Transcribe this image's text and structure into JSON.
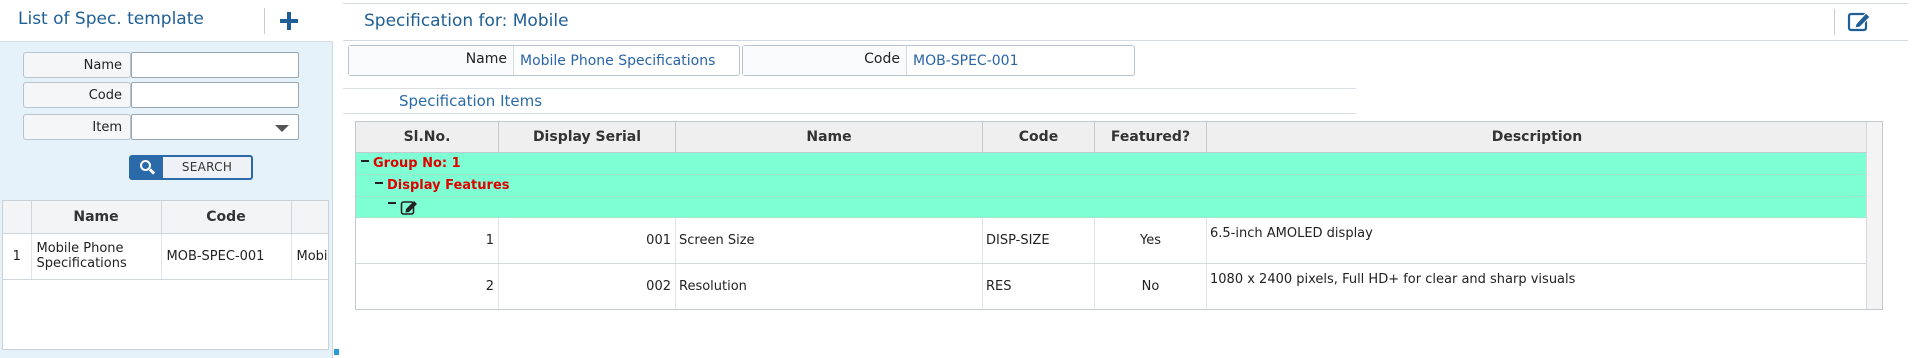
{
  "left_panel": {
    "title": "List of Spec. template",
    "filters": {
      "name_label": "Name",
      "name_value": "",
      "code_label": "Code",
      "code_value": "",
      "item_label": "Item",
      "item_value": ""
    },
    "search_label": "SEARCH",
    "table": {
      "columns": [
        "Name",
        "Code"
      ],
      "rows": [
        {
          "num": "1",
          "name": "Mobile Phone Specifications",
          "code": "MOB-SPEC-001",
          "extra": "Mobil"
        }
      ]
    }
  },
  "right_panel": {
    "title": "Specification for: Mobile",
    "name_label": "Name",
    "name_value": "Mobile Phone Specifications",
    "code_label": "Code",
    "code_value": "MOB-SPEC-001",
    "section_title": "Specification Items",
    "grid": {
      "columns": [
        "Sl.No.",
        "Display Serial",
        "Name",
        "Code",
        "Featured?",
        "Description"
      ],
      "group_label": "Group No: 1",
      "subgroup_label": "Display Features",
      "rows": [
        {
          "sl": "1",
          "serial": "001",
          "name": "Screen Size",
          "code": "DISP-SIZE",
          "featured": "Yes",
          "description": "6.5-inch AMOLED display"
        },
        {
          "sl": "2",
          "serial": "002",
          "name": "Resolution",
          "code": "RES",
          "featured": "No",
          "description": "1080 x 2400 pixels, Full HD+ for clear and sharp visuals"
        }
      ]
    }
  },
  "colors": {
    "accent": "#1f5f95",
    "group_band": "#7fffd4",
    "group_text": "#e00000",
    "value_text": "#2a64a8"
  },
  "icons": [
    "plus-icon",
    "search-icon",
    "edit-icon",
    "chevron-down-icon",
    "collapse-icon"
  ]
}
